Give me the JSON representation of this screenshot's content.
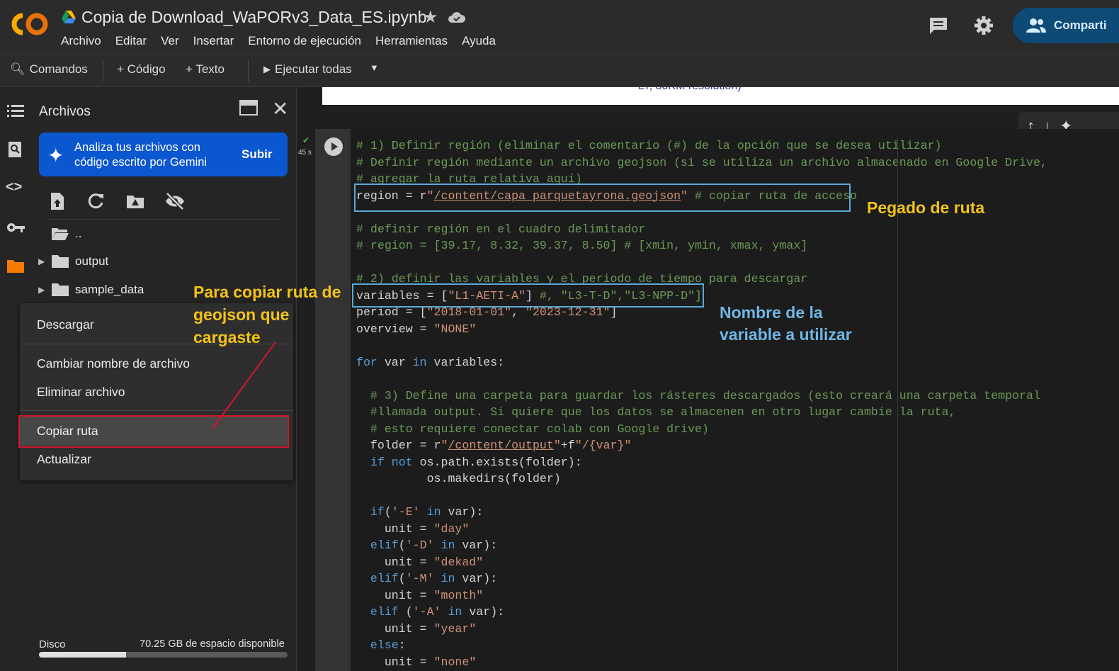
{
  "header": {
    "title": "Copia de Download_WaPORv3_Data_ES.ipynb",
    "menu": [
      "Archivo",
      "Editar",
      "Ver",
      "Insertar",
      "Entorno de ejecución",
      "Herramientas",
      "Ayuda"
    ],
    "share_label": "Comparti"
  },
  "toolbar": {
    "commands": "Comandos",
    "code": "+ Código",
    "text": "+ Texto",
    "run_all": "Ejecutar todas"
  },
  "panel": {
    "title": "Archivos",
    "gemini_text_1": "Analiza tus archivos con",
    "gemini_text_2": "código escrito por Gemini",
    "upload": "Subir",
    "tree": [
      "..",
      "output",
      "sample_data"
    ],
    "disk_label": "Disco",
    "disk_free": "70.25 GB de espacio disponible",
    "disk_used_fraction": 0.35
  },
  "context_menu": {
    "items": [
      "Descargar",
      "Cambiar nombre de archivo",
      "Eliminar archivo",
      "Copiar ruta",
      "Actualizar"
    ]
  },
  "cell": {
    "run_time": "45 s",
    "top_strip_text": "LT, 30KM resolution)",
    "lines": [
      [
        [
          "cm",
          "# 1) Definir región (eliminar el comentario (#) de la opción que se desea utilizar)"
        ]
      ],
      [
        [
          "cm",
          "# Definir región mediante un archivo geojson (si se utiliza un archivo almacenado en Google Drive,"
        ]
      ],
      [
        [
          "cm",
          "# agregar la ruta relativa aquí)"
        ]
      ],
      [
        [
          "pl",
          "region = r"
        ],
        [
          "st",
          "\""
        ],
        [
          "st ul",
          "/content/capa_parquetayrona.geojson"
        ],
        [
          "st",
          "\""
        ],
        [
          "cm",
          " # copiar ruta de acceso"
        ]
      ],
      [
        [
          "pl",
          ""
        ]
      ],
      [
        [
          "cm",
          "# definir región en el cuadro delimitador"
        ]
      ],
      [
        [
          "cm",
          "# region = [39.17, 8.32, 39.37, 8.50] # [xmin, ymin, xmax, ymax]"
        ]
      ],
      [
        [
          "pl",
          ""
        ]
      ],
      [
        [
          "cm",
          "# 2) definir las variables y el periodo de tiempo para descargar"
        ]
      ],
      [
        [
          "pl",
          "variables = ["
        ],
        [
          "st",
          "\"L1-AETI-A\""
        ],
        [
          "pl",
          "] "
        ],
        [
          "cm",
          "#, \"L3-T-D\",\"L3-NPP-D\"]"
        ]
      ],
      [
        [
          "pl",
          "period = ["
        ],
        [
          "st",
          "\"2018-01-01\""
        ],
        [
          "pl",
          ", "
        ],
        [
          "st",
          "\"2023-12-31\""
        ],
        [
          "pl",
          "]"
        ]
      ],
      [
        [
          "pl",
          "overview = "
        ],
        [
          "st",
          "\"NONE\""
        ]
      ],
      [
        [
          "pl",
          ""
        ]
      ],
      [
        [
          "kw",
          "for"
        ],
        [
          "pl",
          " var "
        ],
        [
          "kw",
          "in"
        ],
        [
          "pl",
          " variables:"
        ]
      ],
      [
        [
          "pl",
          ""
        ]
      ],
      [
        [
          "cm",
          "  # 3) Define una carpeta para guardar los rásteres descargados (esto creará una carpeta temporal"
        ]
      ],
      [
        [
          "cm",
          "  #llamada output. Si quiere que los datos se almacenen en otro lugar cambie la ruta,"
        ]
      ],
      [
        [
          "cm",
          "  # esto requiere conectar colab con Google drive)"
        ]
      ],
      [
        [
          "pl",
          "  folder = r"
        ],
        [
          "st",
          "\""
        ],
        [
          "st ul",
          "/content/output"
        ],
        [
          "st",
          "\""
        ],
        [
          "pl",
          "+f"
        ],
        [
          "st",
          "\"/{var}\""
        ]
      ],
      [
        [
          "kw",
          "  if not"
        ],
        [
          "pl",
          " os.path.exists(folder):"
        ]
      ],
      [
        [
          "pl",
          "          os.makedirs(folder)"
        ]
      ],
      [
        [
          "pl",
          ""
        ]
      ],
      [
        [
          "kw",
          "  if"
        ],
        [
          "pl",
          "("
        ],
        [
          "st",
          "'-E'"
        ],
        [
          "kw",
          " in"
        ],
        [
          "pl",
          " var):"
        ]
      ],
      [
        [
          "pl",
          "    unit = "
        ],
        [
          "st",
          "\"day\""
        ]
      ],
      [
        [
          "kw",
          "  elif"
        ],
        [
          "pl",
          "("
        ],
        [
          "st",
          "'-D'"
        ],
        [
          "kw",
          " in"
        ],
        [
          "pl",
          " var):"
        ]
      ],
      [
        [
          "pl",
          "    unit = "
        ],
        [
          "st",
          "\"dekad\""
        ]
      ],
      [
        [
          "kw",
          "  elif"
        ],
        [
          "pl",
          "("
        ],
        [
          "st",
          "'-M'"
        ],
        [
          "kw",
          " in"
        ],
        [
          "pl",
          " var):"
        ]
      ],
      [
        [
          "pl",
          "    unit = "
        ],
        [
          "st",
          "\"month\""
        ]
      ],
      [
        [
          "kw",
          "  elif"
        ],
        [
          "pl",
          " ("
        ],
        [
          "st",
          "'-A'"
        ],
        [
          "kw",
          " in"
        ],
        [
          "pl",
          " var):"
        ]
      ],
      [
        [
          "pl",
          "    unit = "
        ],
        [
          "st",
          "\"year\""
        ]
      ],
      [
        [
          "kw",
          "  else"
        ],
        [
          "pl",
          ":"
        ]
      ],
      [
        [
          "pl",
          "    unit = "
        ],
        [
          "st",
          "\"none\""
        ]
      ]
    ]
  },
  "annotations": {
    "pegado": "Pegado de ruta",
    "nombre_1": "Nombre de la",
    "nombre_2": "variable a utilizar",
    "copiar_1": "Para copiar ruta de",
    "copiar_2": "geojson que",
    "copiar_3": "cargaste"
  },
  "colors": {
    "accent": "#0b57d0",
    "annotation_yellow": "#f2c318",
    "annotation_blue": "#6fb6e6",
    "highlight_red": "#d3162a"
  }
}
